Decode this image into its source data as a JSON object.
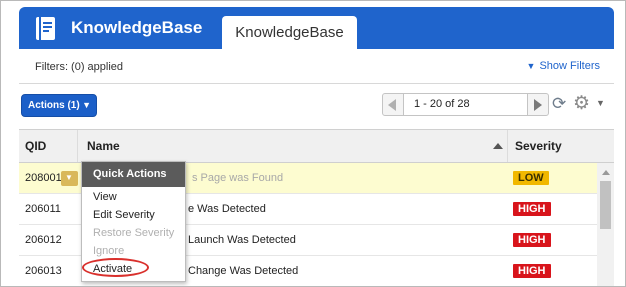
{
  "app": {
    "title": "KnowledgeBase",
    "tab": "KnowledgeBase",
    "icon": "book-icon"
  },
  "filters": {
    "applied_text": "Filters: (0) applied",
    "show_label": "Show Filters"
  },
  "toolbar": {
    "actions_label": "Actions (1)",
    "page_range": "1 - 20 of 28",
    "icons": [
      "prev-page-icon",
      "next-page-icon",
      "refresh-icon",
      "gear-icon"
    ]
  },
  "table": {
    "columns": [
      "QID",
      "Name",
      "Severity"
    ],
    "rows": [
      {
        "qid": "208001",
        "name": "s Page was Found",
        "severity": "LOW"
      },
      {
        "qid": "206011",
        "name": "e Was Detected",
        "severity": "HIGH"
      },
      {
        "qid": "206012",
        "name": "Launch Was Detected",
        "severity": "HIGH"
      },
      {
        "qid": "206013",
        "name": "Change Was Detected",
        "severity": "HIGH"
      }
    ]
  },
  "quick_actions": {
    "title": "Quick Actions",
    "items": [
      {
        "label": "View",
        "enabled": true
      },
      {
        "label": "Edit Severity",
        "enabled": true
      },
      {
        "label": "Restore Severity",
        "enabled": false
      },
      {
        "label": "Ignore",
        "enabled": false
      },
      {
        "label": "Activate",
        "enabled": true
      }
    ]
  },
  "colors": {
    "brand_blue": "#1f64cc",
    "severity_low": "#f1b800",
    "severity_high": "#d8141b",
    "highlight_ring": "#d9302c",
    "selected_row": "#fdfcd0"
  }
}
